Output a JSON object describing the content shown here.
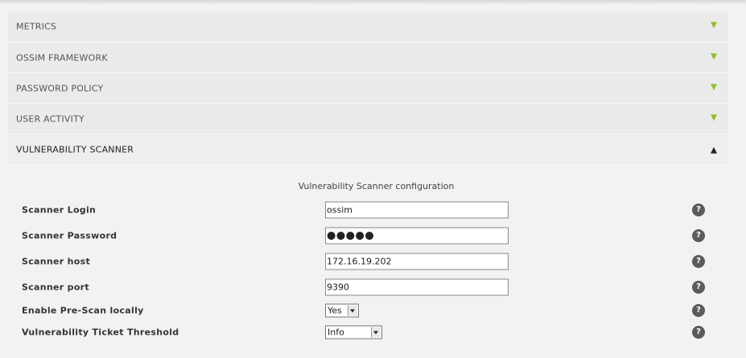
{
  "accordion": {
    "sections": [
      {
        "label": "METRICS",
        "state": "collapsed"
      },
      {
        "label": "OSSIM FRAMEWORK",
        "state": "collapsed"
      },
      {
        "label": "PASSWORD POLICY",
        "state": "collapsed"
      },
      {
        "label": "USER ACTIVITY",
        "state": "collapsed"
      },
      {
        "label": "VULNERABILITY SCANNER",
        "state": "expanded"
      }
    ],
    "collapsed_arrow_color": "#8dc41f"
  },
  "scanner": {
    "title": "Vulnerability Scanner configuration",
    "fields": {
      "login": {
        "label": "Scanner Login",
        "value": "ossim"
      },
      "password": {
        "label": "Scanner Password",
        "masked_value": "●●●●●"
      },
      "host": {
        "label": "Scanner host",
        "value": "172.16.19.202"
      },
      "port": {
        "label": "Scanner port",
        "value": "9390"
      },
      "prescan": {
        "label": "Enable Pre-Scan locally",
        "selected": "Yes"
      },
      "threshold": {
        "label": "Vulnerability Ticket Threshold",
        "selected": "Info"
      }
    },
    "help_glyph": "?"
  }
}
